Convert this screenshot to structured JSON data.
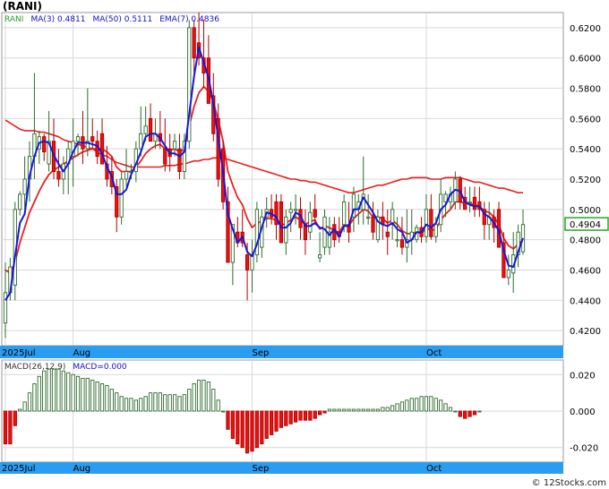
{
  "title": "(RANI)",
  "watermark": "© 12Stocks.com",
  "chart_data": [
    {
      "type": "candlestick",
      "legend": [
        {
          "label": "RANI",
          "color": "#22aa22"
        },
        {
          "label": "MA(3)",
          "value": "0.4811",
          "color": "#1111cc"
        },
        {
          "label": "MA(50)",
          "value": "0.5111",
          "color": "#1111cc"
        },
        {
          "label": "EMA(7)",
          "value": "0.4836",
          "color": "#1111cc"
        }
      ],
      "ylim": [
        0.41,
        0.63
      ],
      "yticks": [
        "0.4200",
        "0.4400",
        "0.4600",
        "0.4800",
        "0.5000",
        "0.5200",
        "0.5400",
        "0.5600",
        "0.5800",
        "0.6000",
        "0.6200"
      ],
      "last_price": "0.4904",
      "x_labels": [
        {
          "label": "2025Jul",
          "index": 0
        },
        {
          "label": "Aug",
          "index": 14
        },
        {
          "label": "Sep",
          "index": 51
        },
        {
          "label": "Oct",
          "index": 87
        }
      ],
      "candles": [
        [
          0.425,
          0.465,
          0.415,
          0.445
        ],
        [
          0.445,
          0.468,
          0.44,
          0.462
        ],
        [
          0.45,
          0.505,
          0.44,
          0.5
        ],
        [
          0.5,
          0.512,
          0.496,
          0.51
        ],
        [
          0.51,
          0.535,
          0.5,
          0.52
        ],
        [
          0.52,
          0.545,
          0.505,
          0.535
        ],
        [
          0.535,
          0.59,
          0.52,
          0.55
        ],
        [
          0.54,
          0.552,
          0.53,
          0.548
        ],
        [
          0.548,
          0.55,
          0.532,
          0.538
        ],
        [
          0.53,
          0.565,
          0.525,
          0.545
        ],
        [
          0.545,
          0.56,
          0.52,
          0.525
        ],
        [
          0.525,
          0.54,
          0.515,
          0.52
        ],
        [
          0.52,
          0.535,
          0.51,
          0.53
        ],
        [
          0.53,
          0.545,
          0.51,
          0.54
        ],
        [
          0.535,
          0.56,
          0.515,
          0.545
        ],
        [
          0.545,
          0.55,
          0.535,
          0.548
        ],
        [
          0.548,
          0.565,
          0.53,
          0.54
        ],
        [
          0.54,
          0.58,
          0.535,
          0.545
        ],
        [
          0.548,
          0.56,
          0.54,
          0.545
        ],
        [
          0.545,
          0.552,
          0.53,
          0.535
        ],
        [
          0.55,
          0.56,
          0.53,
          0.53
        ],
        [
          0.53,
          0.542,
          0.515,
          0.52
        ],
        [
          0.525,
          0.535,
          0.51,
          0.515
        ],
        [
          0.515,
          0.52,
          0.485,
          0.495
        ],
        [
          0.495,
          0.525,
          0.49,
          0.52
        ],
        [
          0.52,
          0.54,
          0.515,
          0.525
        ],
        [
          0.525,
          0.53,
          0.52,
          0.525
        ],
        [
          0.525,
          0.545,
          0.518,
          0.54
        ],
        [
          0.54,
          0.568,
          0.535,
          0.55
        ],
        [
          0.55,
          0.568,
          0.545,
          0.555
        ],
        [
          0.56,
          0.57,
          0.55,
          0.545
        ],
        [
          0.545,
          0.56,
          0.54,
          0.55
        ],
        [
          0.55,
          0.565,
          0.54,
          0.545
        ],
        [
          0.54,
          0.56,
          0.525,
          0.53
        ],
        [
          0.54,
          0.55,
          0.525,
          0.535
        ],
        [
          0.54,
          0.55,
          0.535,
          0.545
        ],
        [
          0.54,
          0.55,
          0.52,
          0.525
        ],
        [
          0.525,
          0.55,
          0.52,
          0.545
        ],
        [
          0.545,
          0.625,
          0.54,
          0.62
        ],
        [
          0.62,
          0.625,
          0.59,
          0.6
        ],
        [
          0.61,
          0.63,
          0.595,
          0.6
        ],
        [
          0.6,
          0.625,
          0.58,
          0.59
        ],
        [
          0.6,
          0.615,
          0.57,
          0.57
        ],
        [
          0.575,
          0.59,
          0.545,
          0.55
        ],
        [
          0.56,
          0.57,
          0.515,
          0.52
        ],
        [
          0.54,
          0.545,
          0.5,
          0.505
        ],
        [
          0.505,
          0.515,
          0.465,
          0.465
        ],
        [
          0.465,
          0.49,
          0.45,
          0.49
        ],
        [
          0.485,
          0.495,
          0.475,
          0.478
        ],
        [
          0.485,
          0.5,
          0.475,
          0.478
        ],
        [
          0.47,
          0.478,
          0.44,
          0.46
        ],
        [
          0.46,
          0.48,
          0.445,
          0.47
        ],
        [
          0.47,
          0.505,
          0.465,
          0.5
        ],
        [
          0.475,
          0.5,
          0.468,
          0.495
        ],
        [
          0.495,
          0.508,
          0.488,
          0.5
        ],
        [
          0.5,
          0.51,
          0.49,
          0.495
        ],
        [
          0.505,
          0.51,
          0.48,
          0.49
        ],
        [
          0.505,
          0.51,
          0.48,
          0.478
        ],
        [
          0.478,
          0.5,
          0.47,
          0.495
        ],
        [
          0.498,
          0.505,
          0.485,
          0.5
        ],
        [
          0.5,
          0.51,
          0.49,
          0.5
        ],
        [
          0.5,
          0.508,
          0.48,
          0.488
        ],
        [
          0.49,
          0.5,
          0.47,
          0.48
        ],
        [
          0.485,
          0.505,
          0.48,
          0.498
        ],
        [
          0.5,
          0.51,
          0.49,
          0.495
        ],
        [
          0.468,
          0.485,
          0.465,
          0.47
        ],
        [
          0.475,
          0.5,
          0.47,
          0.495
        ],
        [
          0.475,
          0.495,
          0.47,
          0.485
        ],
        [
          0.49,
          0.495,
          0.475,
          0.48
        ],
        [
          0.485,
          0.495,
          0.478,
          0.482
        ],
        [
          0.49,
          0.51,
          0.485,
          0.505
        ],
        [
          0.49,
          0.505,
          0.478,
          0.485
        ],
        [
          0.495,
          0.515,
          0.485,
          0.51
        ],
        [
          0.5,
          0.51,
          0.49,
          0.505
        ],
        [
          0.5,
          0.535,
          0.49,
          0.51
        ],
        [
          0.495,
          0.51,
          0.49,
          0.495
        ],
        [
          0.495,
          0.505,
          0.48,
          0.485
        ],
        [
          0.48,
          0.5,
          0.478,
          0.495
        ],
        [
          0.495,
          0.505,
          0.48,
          0.49
        ],
        [
          0.485,
          0.5,
          0.47,
          0.482
        ],
        [
          0.49,
          0.505,
          0.48,
          0.5
        ],
        [
          0.48,
          0.495,
          0.475,
          0.48
        ],
        [
          0.48,
          0.495,
          0.47,
          0.475
        ],
        [
          0.475,
          0.5,
          0.465,
          0.48
        ],
        [
          0.48,
          0.5,
          0.47,
          0.485
        ],
        [
          0.48,
          0.49,
          0.478,
          0.488
        ],
        [
          0.488,
          0.495,
          0.478,
          0.482
        ],
        [
          0.482,
          0.51,
          0.478,
          0.5
        ],
        [
          0.5,
          0.51,
          0.48,
          0.482
        ],
        [
          0.482,
          0.495,
          0.478,
          0.49
        ],
        [
          0.49,
          0.52,
          0.485,
          0.51
        ],
        [
          0.505,
          0.512,
          0.495,
          0.51
        ],
        [
          0.505,
          0.515,
          0.5,
          0.51
        ],
        [
          0.505,
          0.525,
          0.5,
          0.52
        ],
        [
          0.52,
          0.522,
          0.5,
          0.505
        ],
        [
          0.508,
          0.515,
          0.5,
          0.5
        ],
        [
          0.505,
          0.515,
          0.498,
          0.505
        ],
        [
          0.508,
          0.515,
          0.495,
          0.5
        ],
        [
          0.505,
          0.515,
          0.495,
          0.5
        ],
        [
          0.5,
          0.505,
          0.48,
          0.49
        ],
        [
          0.49,
          0.505,
          0.48,
          0.495
        ],
        [
          0.495,
          0.5,
          0.478,
          0.488
        ],
        [
          0.5,
          0.505,
          0.475,
          0.475
        ],
        [
          0.478,
          0.485,
          0.455,
          0.455
        ],
        [
          0.455,
          0.47,
          0.45,
          0.46
        ],
        [
          0.458,
          0.485,
          0.445,
          0.47
        ],
        [
          0.47,
          0.49,
          0.462,
          0.485
        ],
        [
          0.472,
          0.5,
          0.47,
          0.49
        ]
      ],
      "ema7": [
        0.46,
        0.458,
        0.465,
        0.478,
        0.488,
        0.498,
        0.505,
        0.512,
        0.518,
        0.523,
        0.526,
        0.528,
        0.53,
        0.532,
        0.534,
        0.536,
        0.538,
        0.539,
        0.54,
        0.54,
        0.54,
        0.538,
        0.535,
        0.528,
        0.525,
        0.525,
        0.525,
        0.528,
        0.532,
        0.537,
        0.54,
        0.542,
        0.543,
        0.54,
        0.539,
        0.54,
        0.538,
        0.54,
        0.555,
        0.568,
        0.577,
        0.581,
        0.578,
        0.571,
        0.559,
        0.545,
        0.525,
        0.516,
        0.508,
        0.503,
        0.494,
        0.488,
        0.491,
        0.492,
        0.494,
        0.494,
        0.493,
        0.489,
        0.491,
        0.493,
        0.495,
        0.493,
        0.49,
        0.492,
        0.493,
        0.487,
        0.489,
        0.488,
        0.486,
        0.485,
        0.49,
        0.489,
        0.494,
        0.497,
        0.5,
        0.499,
        0.495,
        0.495,
        0.494,
        0.491,
        0.493,
        0.49,
        0.486,
        0.484,
        0.484,
        0.485,
        0.484,
        0.488,
        0.486,
        0.487,
        0.493,
        0.497,
        0.5,
        0.505,
        0.505,
        0.504,
        0.504,
        0.503,
        0.502,
        0.499,
        0.498,
        0.495,
        0.49,
        0.481,
        0.476,
        0.474,
        0.477,
        0.48
      ],
      "ma3": [
        0.44,
        0.445,
        0.469,
        0.491,
        0.497,
        0.522,
        0.535,
        0.544,
        0.545,
        0.544,
        0.536,
        0.53,
        0.525,
        0.53,
        0.538,
        0.544,
        0.544,
        0.544,
        0.543,
        0.542,
        0.537,
        0.528,
        0.522,
        0.51,
        0.51,
        0.513,
        0.523,
        0.53,
        0.538,
        0.548,
        0.55,
        0.55,
        0.547,
        0.542,
        0.537,
        0.537,
        0.535,
        0.538,
        0.563,
        0.588,
        0.607,
        0.597,
        0.587,
        0.57,
        0.547,
        0.525,
        0.497,
        0.487,
        0.478,
        0.482,
        0.472,
        0.469,
        0.477,
        0.488,
        0.498,
        0.497,
        0.495,
        0.488,
        0.488,
        0.491,
        0.498,
        0.496,
        0.489,
        0.489,
        0.491,
        0.488,
        0.487,
        0.483,
        0.487,
        0.482,
        0.489,
        0.489,
        0.5,
        0.5,
        0.508,
        0.503,
        0.498,
        0.492,
        0.49,
        0.489,
        0.491,
        0.487,
        0.485,
        0.478,
        0.48,
        0.485,
        0.485,
        0.49,
        0.488,
        0.491,
        0.5,
        0.503,
        0.51,
        0.513,
        0.512,
        0.505,
        0.503,
        0.502,
        0.502,
        0.497,
        0.495,
        0.491,
        0.486,
        0.473,
        0.463,
        0.462,
        0.472,
        0.481
      ],
      "ma50": [
        0.559,
        0.557,
        0.555,
        0.553,
        0.552,
        0.552,
        0.552,
        0.551,
        0.551,
        0.55,
        0.549,
        0.548,
        0.546,
        0.545,
        0.544,
        0.543,
        0.542,
        0.541,
        0.54,
        0.538,
        0.536,
        0.535,
        0.533,
        0.531,
        0.53,
        0.529,
        0.528,
        0.528,
        0.528,
        0.528,
        0.528,
        0.528,
        0.528,
        0.529,
        0.529,
        0.529,
        0.53,
        0.53,
        0.531,
        0.532,
        0.532,
        0.533,
        0.533,
        0.534,
        0.534,
        0.534,
        0.533,
        0.532,
        0.531,
        0.53,
        0.529,
        0.528,
        0.527,
        0.526,
        0.525,
        0.524,
        0.523,
        0.522,
        0.521,
        0.52,
        0.52,
        0.519,
        0.519,
        0.518,
        0.518,
        0.517,
        0.516,
        0.515,
        0.514,
        0.513,
        0.512,
        0.511,
        0.511,
        0.512,
        0.513,
        0.514,
        0.515,
        0.516,
        0.516,
        0.517,
        0.518,
        0.519,
        0.52,
        0.52,
        0.521,
        0.521,
        0.521,
        0.521,
        0.52,
        0.52,
        0.52,
        0.521,
        0.521,
        0.521,
        0.521,
        0.52,
        0.519,
        0.518,
        0.518,
        0.517,
        0.516,
        0.515,
        0.514,
        0.514,
        0.513,
        0.512,
        0.511,
        0.511
      ]
    },
    {
      "type": "bar",
      "legend": [
        {
          "label": "MACD(26,12,9)",
          "color": "#333333"
        },
        {
          "label": "MACD=0.000",
          "color": "#1111cc"
        }
      ],
      "ylim": [
        -0.028,
        0.028
      ],
      "yticks": [
        "0.020",
        "0.000",
        "-0.020"
      ],
      "x_labels": [
        {
          "label": "2025Jul",
          "index": 0
        },
        {
          "label": "Aug",
          "index": 14
        },
        {
          "label": "Sep",
          "index": 51
        },
        {
          "label": "Oct",
          "index": 87
        }
      ],
      "values": [
        -0.018,
        -0.018,
        -0.008,
        0.001,
        0.005,
        0.01,
        0.015,
        0.019,
        0.022,
        0.023,
        0.023,
        0.023,
        0.022,
        0.021,
        0.02,
        0.019,
        0.018,
        0.018,
        0.017,
        0.016,
        0.015,
        0.014,
        0.012,
        0.01,
        0.008,
        0.007,
        0.007,
        0.006,
        0.007,
        0.008,
        0.01,
        0.01,
        0.01,
        0.009,
        0.009,
        0.009,
        0.008,
        0.009,
        0.012,
        0.015,
        0.017,
        0.017,
        0.016,
        0.012,
        0.006,
        0.0,
        -0.01,
        -0.015,
        -0.018,
        -0.02,
        -0.023,
        -0.022,
        -0.02,
        -0.018,
        -0.015,
        -0.013,
        -0.011,
        -0.009,
        -0.008,
        -0.007,
        -0.006,
        -0.005,
        -0.005,
        -0.005,
        -0.004,
        -0.002,
        -0.001,
        0.001,
        0.001,
        0.001,
        0.001,
        0.001,
        0.001,
        0.001,
        0.001,
        0.001,
        0.001,
        0.001,
        0.002,
        0.002,
        0.003,
        0.004,
        0.005,
        0.006,
        0.007,
        0.007,
        0.008,
        0.008,
        0.008,
        0.007,
        0.006,
        0.004,
        0.002,
        0.0,
        -0.003,
        -0.004,
        -0.003,
        -0.002,
        0.0
      ]
    }
  ]
}
